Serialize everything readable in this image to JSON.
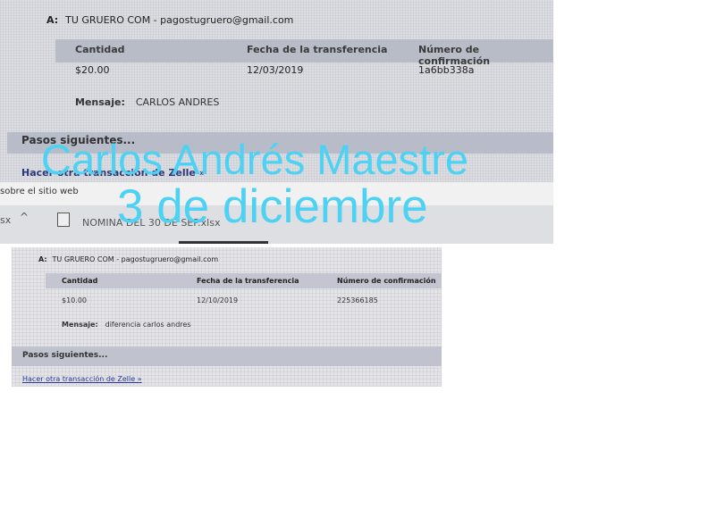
{
  "receipt_1": {
    "to_label": "A:",
    "to_value": "TU GRUERO COM - pagostugruero@gmail.com",
    "headers": [
      "Cantidad",
      "Fecha de la transferencia",
      "Número de confirmación"
    ],
    "amount": "$20.00",
    "date": "12/03/2019",
    "confirmation": "1a6bb338a",
    "message_label": "Mensaje:",
    "message_value": "CARLOS ANDRES",
    "next_steps": "Pasos siguientes...",
    "link_text": "Hacer otra transacción de Zelle »",
    "site_text": "sobre el sitio web",
    "taskbar_x": "sx",
    "taskbar_chevron": "^",
    "taskbar_file": "NOMINA DEL 30 DE SEP.xlsx"
  },
  "overlay": {
    "line1": "Carlos Andrés Maestre",
    "line2": "3 de diciembre",
    "color": "#4dd2f3"
  },
  "receipt_2": {
    "to_label": "A:",
    "to_value": "TU GRUERO COM - pagostugruero@gmail.com",
    "headers": [
      "Cantidad",
      "Fecha de la transferencia",
      "Número de confirmación"
    ],
    "amount": "$10.00",
    "date": "12/10/2019",
    "confirmation": "225366185",
    "message_label": "Mensaje:",
    "message_value": "diferencia carlos andres",
    "next_steps": "Pasos siguientes...",
    "link_text": "Hacer otra transacción de Zelle »"
  }
}
